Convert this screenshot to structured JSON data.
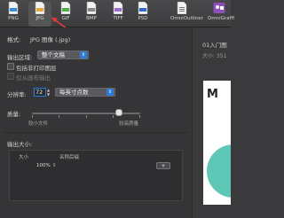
{
  "toolbar": {
    "items": [
      {
        "label": "PNG",
        "icon": "png-file-icon"
      },
      {
        "label": "JPG",
        "icon": "jpg-file-icon",
        "selected": true
      },
      {
        "label": "GIF",
        "icon": "gif-file-icon"
      },
      {
        "label": "BMP",
        "icon": "bmp-file-icon"
      },
      {
        "label": "TIFF",
        "icon": "tiff-file-icon"
      },
      {
        "label": "PSD",
        "icon": "psd-file-icon"
      },
      {
        "label": "OmniOutliner",
        "icon": "omnioutliner-file-icon"
      },
      {
        "label": "OmniGraffl",
        "icon": "omnigraffle-icon"
      }
    ]
  },
  "settings": {
    "format_label": "格式:",
    "format_value": "JPG 图像 (.jpg)",
    "export_area_label": "输出区域:",
    "export_area_value": "整个文稿",
    "include_nonprint_label": "包括非打印图层",
    "transparent_bg_label": "仅从画布输出",
    "resolution_label": "分辨率:",
    "resolution_value": "72",
    "resolution_unit": "每英寸点数",
    "quality_label": "质量:",
    "quality_min_label": "较小文件",
    "quality_max_label": "较高质量",
    "quality_level": 0.8,
    "output_size_label": "输出大小:",
    "table_col_size": "大小",
    "table_col_suffix": "名称后缀",
    "table_row_size": "100%",
    "add_button_label": "+"
  },
  "preview": {
    "title": "01入门图",
    "subtitle": "大小: 351",
    "letter": "M"
  },
  "colors": {
    "accent": "#2f7bd8",
    "annotation_red": "#e23b3b",
    "preview_teal": "#5fc7b6"
  }
}
